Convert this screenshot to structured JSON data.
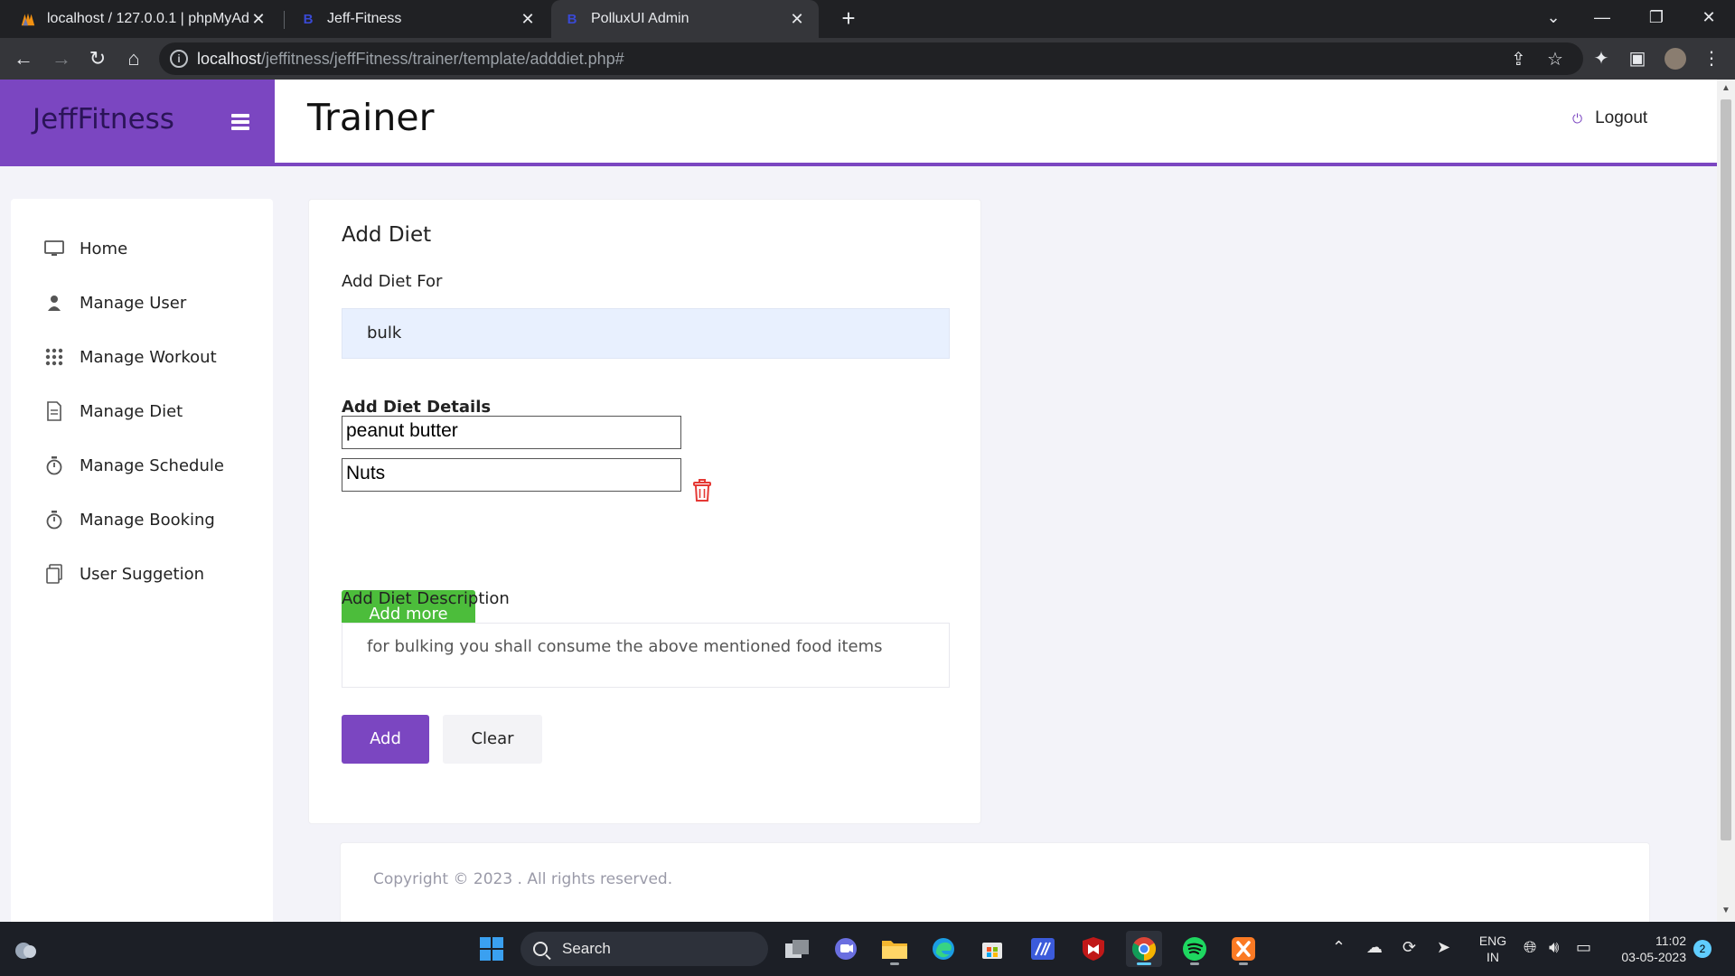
{
  "browser": {
    "tabs": [
      {
        "title": "localhost / 127.0.0.1 | phpMyAdmin",
        "favicon": "phpmyadmin-icon",
        "active": false
      },
      {
        "title": "Jeff-Fitness",
        "favicon": "bootstrap-icon",
        "active": false
      },
      {
        "title": "PolluxUI Admin",
        "favicon": "bootstrap-icon",
        "active": true
      }
    ],
    "url_host": "localhost",
    "url_path": "/jeffitness/jeffFitness/trainer/template/adddiet.php#"
  },
  "app": {
    "brand": "JeffFitness",
    "page_title": "Trainer",
    "logout_label": "Logout",
    "accent_color": "#7b46c1"
  },
  "sidebar": {
    "items": [
      {
        "label": "Home",
        "icon": "monitor-icon"
      },
      {
        "label": "Manage User",
        "icon": "user-icon"
      },
      {
        "label": "Manage Workout",
        "icon": "grid-icon"
      },
      {
        "label": "Manage Diet",
        "icon": "document-icon"
      },
      {
        "label": "Manage Schedule",
        "icon": "stopwatch-icon"
      },
      {
        "label": "Manage Booking",
        "icon": "stopwatch-icon"
      },
      {
        "label": "User Suggetion",
        "icon": "copy-icon"
      }
    ]
  },
  "form": {
    "title": "Add Diet",
    "diet_for_label": "Add Diet For",
    "diet_for_value": "bulk",
    "details_label": "Add Diet Details",
    "details": [
      "peanut butter",
      "Nuts"
    ],
    "add_more_label": "Add more",
    "description_label": "Add Diet Description",
    "description_value": "for bulking you shall consume the above mentioned food items",
    "submit_label": "Add",
    "clear_label": "Clear"
  },
  "footer": {
    "copyright": "Copyright © 2023 . All rights reserved."
  },
  "taskbar": {
    "search_label": "Search",
    "language": "ENG",
    "region": "IN",
    "time": "11:02",
    "date": "03-05-2023",
    "notifications": "2"
  }
}
